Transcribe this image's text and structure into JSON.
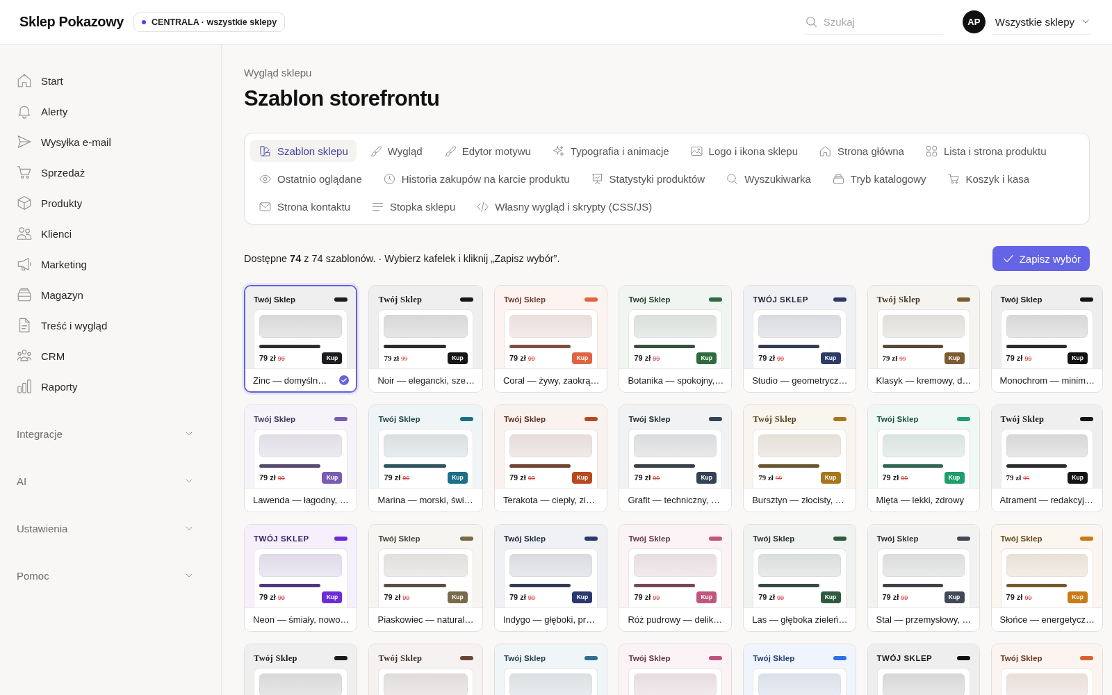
{
  "header": {
    "logo": "Sklep Pokazowy",
    "scope_badge": "CENTRALA · wszystkie sklepy",
    "search": {
      "placeholder": "Szukaj"
    },
    "user": {
      "initials": "AP",
      "store_picker": "Wszystkie sklepy"
    }
  },
  "sidebar": {
    "items": [
      {
        "label": "Start",
        "selected": false
      },
      {
        "label": "Alerty",
        "selected": false
      },
      {
        "label": "Wysyłka e-mail",
        "selected": false
      },
      {
        "label": "Sprzedaż",
        "selected": false
      },
      {
        "label": "Produkty",
        "selected": false
      },
      {
        "label": "Klienci",
        "selected": false
      },
      {
        "label": "Marketing",
        "selected": false
      },
      {
        "label": "Magazyn",
        "selected": false
      },
      {
        "label": "Treść i wygląd",
        "selected": false
      },
      {
        "label": "CRM",
        "selected": false
      },
      {
        "label": "Raporty",
        "selected": false
      }
    ],
    "sections": [
      {
        "label": "Integracje",
        "expanded": false
      },
      {
        "label": "AI",
        "expanded": false
      },
      {
        "label": "Ustawienia",
        "expanded": false
      },
      {
        "label": "Pomoc",
        "expanded": false
      }
    ]
  },
  "breadcrumb": "Wygląd sklepu",
  "title": "Szablon storefrontu",
  "tabs": [
    {
      "label": "Szablon sklepu",
      "selected": true
    },
    {
      "label": "Wygląd",
      "selected": false
    },
    {
      "label": "Edytor motywu",
      "selected": false
    },
    {
      "label": "Typografia i animacje",
      "selected": false
    },
    {
      "label": "Logo i ikona sklepu",
      "selected": false
    },
    {
      "label": "Strona główna",
      "selected": false
    },
    {
      "label": "Lista i strona produktu",
      "selected": false
    },
    {
      "label": "Ostatnio oglądane",
      "selected": false
    },
    {
      "label": "Historia zakupów na karcie produktu",
      "selected": false
    },
    {
      "label": "Statystyki produktów",
      "selected": false
    },
    {
      "label": "Wyszukiwarka",
      "selected": false
    },
    {
      "label": "Tryb katalogowy",
      "selected": false
    },
    {
      "label": "Koszyk i kasa",
      "selected": false
    },
    {
      "label": "Strona kontaktu",
      "selected": false
    },
    {
      "label": "Stopka sklepu",
      "selected": false
    },
    {
      "label": "Własny wygląd i skrypty (CSS/JS)",
      "selected": false
    }
  ],
  "summary": "Dostępne **74** z 74 szablonów. · Wybierz kafelek i kliknij „Zapisz wybór”.",
  "save_button": "Zapisz wybór",
  "templates": [
    {
      "kind": "modern",
      "preview_title": "Twój Sklep",
      "color": "#1c1c1f",
      "price": "79 zł",
      "old_price": "99",
      "buy_label": "Kup",
      "name": "Zinc — domyśln…",
      "selected": true
    },
    {
      "kind": "classic",
      "preview_title": "Twój Sklep",
      "color": "#161616",
      "price": "79 zł",
      "old_price": "99",
      "buy_label": "Kup",
      "name": "Noir — elegancki, sze…",
      "selected": false
    },
    {
      "kind": "modern",
      "preview_title": "Twój Sklep",
      "color": "#e0643f",
      "price": "79 zł",
      "old_price": "99",
      "buy_label": "Kup",
      "name": "Coral — żywy, zaokrą…",
      "selected": false
    },
    {
      "kind": "modern",
      "preview_title": "Twój Sklep",
      "color": "#2f6b3c",
      "price": "79 zł",
      "old_price": "99",
      "buy_label": "Kup",
      "name": "Botanika — spokojny,…",
      "selected": false
    },
    {
      "kind": "display",
      "preview_title": "TWÓJ SKLEP",
      "color": "#2b3b66",
      "price": "79 zł",
      "old_price": "99",
      "buy_label": "Kup",
      "name": "Studio — geometrycz…",
      "selected": false
    },
    {
      "kind": "classic",
      "preview_title": "Twój Sklep",
      "color": "#7b5b30",
      "price": "79 zł",
      "old_price": "99",
      "buy_label": "Kup",
      "name": "Klasyk — kremowy, d…",
      "selected": false
    },
    {
      "kind": "modern",
      "preview_title": "Twój Sklep",
      "color": "#121212",
      "price": "79 zł",
      "old_price": "99",
      "buy_label": "Kup",
      "name": "Monochrom — minim…",
      "selected": false
    },
    {
      "kind": "modern",
      "preview_title": "Twój Sklep",
      "color": "#7a5bb3",
      "price": "79 zł",
      "old_price": "99",
      "buy_label": "Kup",
      "name": "Lawenda — łagodny, …",
      "selected": false
    },
    {
      "kind": "modern",
      "preview_title": "Twój Sklep",
      "color": "#1c6f88",
      "price": "79 zł",
      "old_price": "99",
      "buy_label": "Kup",
      "name": "Marina — morski, świ…",
      "selected": false
    },
    {
      "kind": "modern",
      "preview_title": "Twój Sklep",
      "color": "#b8491e",
      "price": "79 zł",
      "old_price": "99",
      "buy_label": "Kup",
      "name": "Terakota — ciepły, zi…",
      "selected": false
    },
    {
      "kind": "modern",
      "preview_title": "Twój Sklep",
      "color": "#344255",
      "price": "79 zł",
      "old_price": "99",
      "buy_label": "Kup",
      "name": "Grafit — techniczny, …",
      "selected": false
    },
    {
      "kind": "classic",
      "preview_title": "Twój Sklep",
      "color": "#a8761c",
      "price": "79 zł",
      "old_price": "99",
      "buy_label": "Kup",
      "name": "Bursztyn — złocisty, …",
      "selected": false
    },
    {
      "kind": "modern",
      "preview_title": "Twój Sklep",
      "color": "#1f9e6c",
      "price": "79 zł",
      "old_price": "99",
      "buy_label": "Kup",
      "name": "Mięta — lekki, zdrowy",
      "selected": false
    },
    {
      "kind": "classic",
      "preview_title": "Twój Sklep",
      "color": "#141414",
      "price": "79 zł",
      "old_price": "99",
      "buy_label": "Kup",
      "name": "Atrament — redakcyj…",
      "selected": false
    },
    {
      "kind": "display",
      "preview_title": "TWÓJ SKLEP",
      "color": "#6d2bd9",
      "price": "79 zł",
      "old_price": "99",
      "buy_label": "Kup",
      "name": "Neon — śmiały, nowo…",
      "selected": false
    },
    {
      "kind": "modern",
      "preview_title": "Twój Sklep",
      "color": "#7a6a49",
      "price": "79 zł",
      "old_price": "99",
      "buy_label": "Kup",
      "name": "Piaskowiec — natural…",
      "selected": false
    },
    {
      "kind": "modern",
      "preview_title": "Twój Sklep",
      "color": "#29396f",
      "price": "79 zł",
      "old_price": "99",
      "buy_label": "Kup",
      "name": "Indygo — głęboki, pr…",
      "selected": false
    },
    {
      "kind": "modern",
      "preview_title": "Twój Sklep",
      "color": "#c2557f",
      "price": "79 zł",
      "old_price": "99",
      "buy_label": "Kup",
      "name": "Róż pudrowy — delik…",
      "selected": false
    },
    {
      "kind": "modern",
      "preview_title": "Twój Sklep",
      "color": "#2e5a3e",
      "price": "79 zł",
      "old_price": "99",
      "buy_label": "Kup",
      "name": "Las — głęboka zieleń…",
      "selected": false
    },
    {
      "kind": "modern",
      "preview_title": "Twój Sklep",
      "color": "#404a56",
      "price": "79 zł",
      "old_price": "99",
      "buy_label": "Kup",
      "name": "Stal — przemysłowy, …",
      "selected": false
    },
    {
      "kind": "modern",
      "preview_title": "Twój Sklep",
      "color": "#c97b14",
      "price": "79 zł",
      "old_price": "99",
      "buy_label": "Kup",
      "name": "Słońce — energetycz…",
      "selected": false
    },
    {
      "kind": "classic",
      "preview_title": "Twój Sklep",
      "color": "#1a1a1a",
      "selected": false
    },
    {
      "kind": "classic",
      "preview_title": "Twój Sklep",
      "color": "#6b4636",
      "selected": false
    },
    {
      "kind": "modern",
      "preview_title": "Twój Sklep",
      "color": "#2f6e91",
      "selected": false
    },
    {
      "kind": "modern",
      "preview_title": "Twój Sklep",
      "color": "#c2507e",
      "selected": false
    },
    {
      "kind": "modern",
      "preview_title": "Twój Sklep",
      "color": "#2f6fe8",
      "selected": false
    },
    {
      "kind": "display",
      "preview_title": "TWÓJ SKLEP",
      "color": "#111111",
      "selected": false
    },
    {
      "kind": "modern",
      "preview_title": "Twój Sklep",
      "color": "#d9602a",
      "selected": false
    }
  ]
}
